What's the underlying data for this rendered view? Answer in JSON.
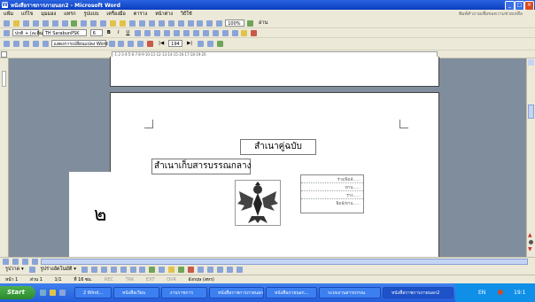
{
  "window": {
    "title": "หนังสือราชการภายนอก2 - Microsoft Word"
  },
  "menu": {
    "items": [
      "แฟ้ม",
      "แก้ไข",
      "มุมมอง",
      "แทรก",
      "รูปแบบ",
      "เครื่องมือ",
      "ตาราง",
      "หน้าต่าง",
      "วิธีใช้"
    ],
    "help_placeholder": "พิมพ์คำถามเพื่อขอความช่วยเหลือ"
  },
  "toolbar": {
    "zoom": "100%",
    "read_label": "อ่าน",
    "style": "ปกติ + (ละตินฯ)",
    "font": "TH SarabunPSK",
    "font_size": "6",
    "bold": "B",
    "italic": "I",
    "underline": "U",
    "lang_label": "แสดงการเปลี่ยนแปลง Word",
    "page_input": "194"
  },
  "document": {
    "numeral": "๒",
    "copy_label": "สำเนาคู่ฉบับ",
    "central_label": "สำเนาเก็บสารบรรณกลาง",
    "sign_lines": [
      "ร่าง/พิมพ์......",
      "ทาน......",
      "ร่าง......",
      "พิมพ์/ทาน......"
    ]
  },
  "drawbar": {
    "draw_label": "รูปวาด ▾",
    "autoshape_label": "รูปร่างอัตโนมัติ ▾"
  },
  "status": {
    "page": "หน้า 1",
    "section": "ส่วน 1",
    "pages": "1/1",
    "at": "ที่ 16 ซม.",
    "rec": "REC",
    "trk": "TRK",
    "ext": "EXT",
    "ovr": "OVR",
    "lang": "อังกฤษ (สหร)"
  },
  "taskbar": {
    "start": "Start",
    "tasks": [
      "2 Wind...",
      "หนังสือเวียน",
      "งานราชการ",
      "หนังสือราชการภายนอก",
      "หนังสือภายนอก...",
      "ระบบงานสารบรรณ",
      "หนังสือราชการภายนอก2"
    ],
    "lang": "EN",
    "clock": "19:1"
  },
  "colors": {
    "titlebar": "#245edb",
    "workspace": "#808d9c",
    "taskbar": "#245edb",
    "start": "#3a9b3a"
  }
}
